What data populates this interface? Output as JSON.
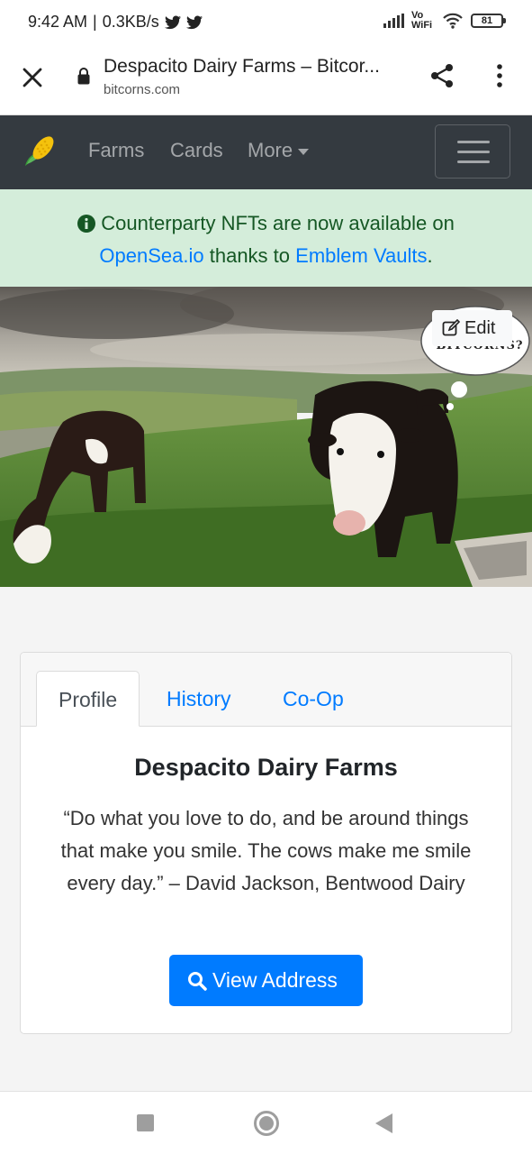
{
  "status_bar": {
    "time": "9:42 AM",
    "speed": "0.3KB/s",
    "network": "Vo WiFi",
    "battery": "81"
  },
  "browser": {
    "page_title": "Despacito Dairy Farms – Bitcor...",
    "domain": "bitcorns.com",
    "icons": [
      "close-icon",
      "lock-icon",
      "share-icon",
      "more-vert-icon"
    ]
  },
  "navbar": {
    "brand_icon": "corn-icon",
    "links": [
      "Farms",
      "Cards",
      "More"
    ],
    "toggler_icon": "hamburger-icon"
  },
  "alert": {
    "text_1": "Counterparty NFTs are now available on",
    "link_1": "OpenSea.io",
    "text_2": "thanks to",
    "link_2": "Emblem Vaults",
    "text_3": ".",
    "icon": "info-circle-icon"
  },
  "hero": {
    "edit_label": "Edit",
    "bubble_text": "BITCORNS?",
    "description": "cows grazing on hillside"
  },
  "profile": {
    "tabs": [
      "Profile",
      "History",
      "Co-Op"
    ],
    "active_tab": "Profile",
    "farm_name": "Despacito Dairy Farms",
    "quote": "“Do what you love to do, and be around things that make you smile. The cows make me smile every day.” – David Jackson, Bentwood Dairy",
    "button_label": "View Address"
  },
  "colors": {
    "navbar_bg": "#343a40",
    "alert_bg": "#d4edda",
    "alert_text": "#155724",
    "link": "#007bff",
    "button": "#007bff"
  }
}
